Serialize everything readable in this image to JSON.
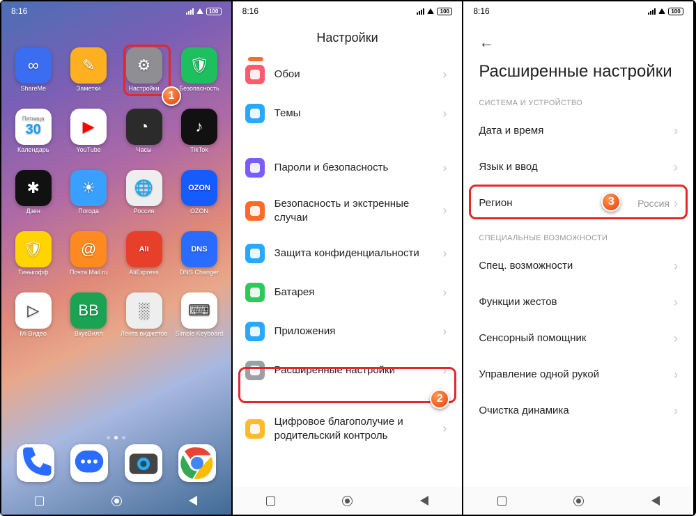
{
  "status": {
    "time": "8:16",
    "battery": "100"
  },
  "step_badges": {
    "s1": "1",
    "s2": "2",
    "s3": "3"
  },
  "home": {
    "apps": [
      {
        "label": "ShareMe",
        "bg": "#3a6df0",
        "glyph": "∞"
      },
      {
        "label": "Заметки",
        "bg": "#ffb020",
        "glyph": "✎"
      },
      {
        "label": "Настройки",
        "bg": "#8e8e93",
        "glyph": "⚙"
      },
      {
        "label": "Безопасность",
        "bg": "#1dbf5e",
        "glyph": "🛡"
      },
      {
        "label": "Календарь",
        "sub": "Пятница",
        "day": "30",
        "bg": "#ffffff",
        "glyph": ""
      },
      {
        "label": "YouTube",
        "bg": "#ffffff",
        "glyph": "▶"
      },
      {
        "label": "Часы",
        "bg": "#2b2b2b",
        "glyph": "◔"
      },
      {
        "label": "TikTok",
        "bg": "#111111",
        "glyph": "♪"
      },
      {
        "label": "Дзен",
        "bg": "#111111",
        "glyph": "✱"
      },
      {
        "label": "Погода",
        "bg": "#3aa0ff",
        "glyph": "☀"
      },
      {
        "label": "Россия",
        "bg": "#eeeeee",
        "glyph": "🌐"
      },
      {
        "label": "OZON",
        "bg": "#155cff",
        "glyph": "OZON"
      },
      {
        "label": "Тинькофф",
        "bg": "#ffd400",
        "glyph": "🛡"
      },
      {
        "label": "Почта Mail.ru",
        "bg": "#ff8a1f",
        "glyph": "@"
      },
      {
        "label": "AliExpress",
        "bg": "#e83f2a",
        "glyph": "Ali"
      },
      {
        "label": "DNS Changer",
        "bg": "#2a6cff",
        "glyph": "DNS"
      },
      {
        "label": "Mi Видео",
        "bg": "#ffffff",
        "glyph": "▷"
      },
      {
        "label": "ВкусВилл",
        "bg": "#1aa352",
        "glyph": "ВВ"
      },
      {
        "label": "Лента виджетов",
        "bg": "#eeeeee",
        "glyph": "░"
      },
      {
        "label": "Simple Keyboard",
        "bg": "#ffffff",
        "glyph": "⌨"
      }
    ],
    "dock": [
      {
        "bg": "#ffffff",
        "glyph": "phone"
      },
      {
        "bg": "#ffffff",
        "glyph": "chat"
      },
      {
        "bg": "#ffffff",
        "glyph": "camera"
      },
      {
        "bg": "#ffffff",
        "glyph": "chrome"
      }
    ]
  },
  "settings": {
    "title": "Настройки",
    "items": [
      {
        "label": "Обои",
        "color": "#ff5a6e"
      },
      {
        "label": "Темы",
        "color": "#2aa8ff"
      },
      {
        "label": "Пароли и безопасность",
        "color": "#7a5cff"
      },
      {
        "label": "Безопасность и экстренные случаи",
        "color": "#ff6a2b"
      },
      {
        "label": "Защита конфиденциальности",
        "color": "#2aa8ff"
      },
      {
        "label": "Батарея",
        "color": "#2dc95a"
      },
      {
        "label": "Приложения",
        "color": "#2aa8ff"
      },
      {
        "label": "Расширенные настройки",
        "color": "#9aa0a6"
      },
      {
        "label": "Цифровое благополучие и родительский контроль",
        "color": "#fdbb2c"
      }
    ]
  },
  "advanced": {
    "title": "Расширенные настройки",
    "sections": [
      {
        "header": "СИСТЕМА И УСТРОЙСТВО",
        "items": [
          {
            "label": "Дата и время"
          },
          {
            "label": "Язык и ввод"
          },
          {
            "label": "Регион",
            "value": "Россия"
          }
        ]
      },
      {
        "header": "СПЕЦИАЛЬНЫЕ ВОЗМОЖНОСТИ",
        "items": [
          {
            "label": "Спец. возможности"
          },
          {
            "label": "Функции жестов"
          },
          {
            "label": "Сенсорный помощник"
          },
          {
            "label": "Управление одной рукой"
          },
          {
            "label": "Очистка динамика"
          }
        ]
      }
    ]
  }
}
